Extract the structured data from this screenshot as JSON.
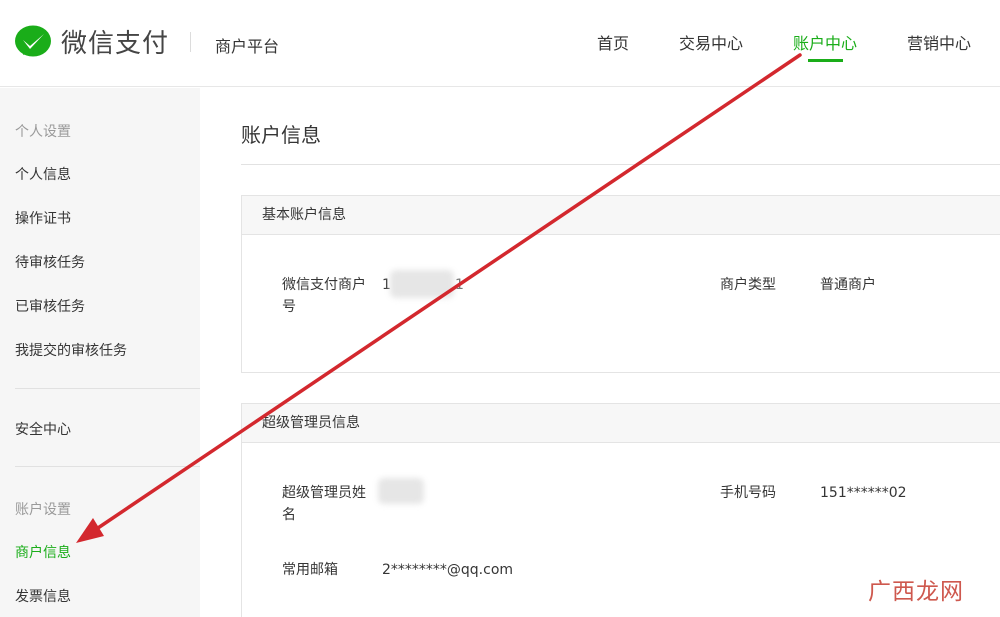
{
  "header": {
    "brand": "微信支付",
    "platform": "商户平台",
    "nav": [
      {
        "label": "首页"
      },
      {
        "label": "交易中心"
      },
      {
        "label": "账户中心"
      },
      {
        "label": "营销中心"
      }
    ],
    "active_nav": "账户中心"
  },
  "sidebar": {
    "group_personal": "个人设置",
    "items_personal": [
      {
        "label": "个人信息"
      },
      {
        "label": "操作证书"
      },
      {
        "label": "待审核任务"
      },
      {
        "label": "已审核任务"
      },
      {
        "label": "我提交的审核任务"
      }
    ],
    "security": "安全中心",
    "group_account": "账户设置",
    "items_account": [
      {
        "label": "商户信息"
      },
      {
        "label": "发票信息"
      }
    ],
    "active_item": "商户信息"
  },
  "main": {
    "title": "账户信息",
    "basic": {
      "heading": "基本账户信息",
      "merchant_id_label_line1": "微信支付商户",
      "merchant_id_label_line2": "号",
      "merchant_id_prefix": "1",
      "merchant_id_suffix": "1",
      "merchant_type_label": "商户类型",
      "merchant_type_value": "普通商户"
    },
    "admin": {
      "heading": "超级管理员信息",
      "name_label_line1": "超级管理员姓",
      "name_label_line2": "名",
      "phone_label": "手机号码",
      "phone_value": "151******02",
      "email_label": "常用邮箱",
      "email_value": "2********@qq.com"
    }
  },
  "watermark": "广西龙网",
  "colors": {
    "accent": "#1aad19",
    "annotation_arrow": "#d3282e",
    "sidebar_bg": "#f6f6f6"
  }
}
